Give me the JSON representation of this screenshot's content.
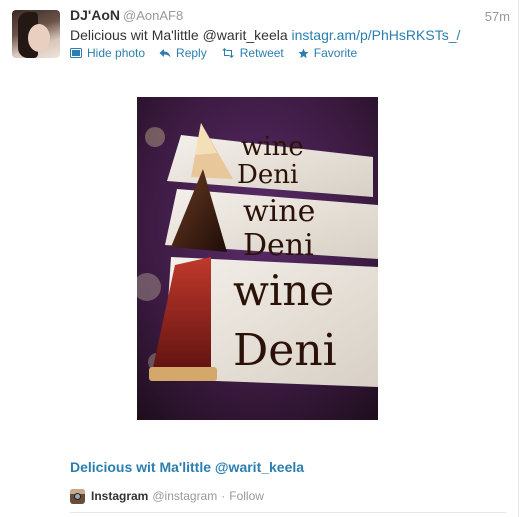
{
  "tweet": {
    "fullname": "DJ'AoN",
    "username": "@AonAF8",
    "time": "57m",
    "text": "Delicious wit Ma'little @warit_keela",
    "link": "instagr.am/p/PhHsRKSTs_/"
  },
  "actions": {
    "hide_photo": "Hide photo",
    "reply": "Reply",
    "retweet": "Retweet",
    "favorite": "Favorite"
  },
  "photo": {
    "plate_text": [
      "wine",
      "Deni",
      "wine",
      "Deni",
      "wine",
      "Deni"
    ]
  },
  "card": {
    "title": "Delicious wit Ma'little @warit_keela"
  },
  "attribution": {
    "name": "Instagram",
    "handle": "@instagram",
    "separator": "·",
    "follow": "Follow"
  },
  "colors": {
    "link": "#2a7fb0",
    "muted": "#999999",
    "text": "#333333"
  }
}
